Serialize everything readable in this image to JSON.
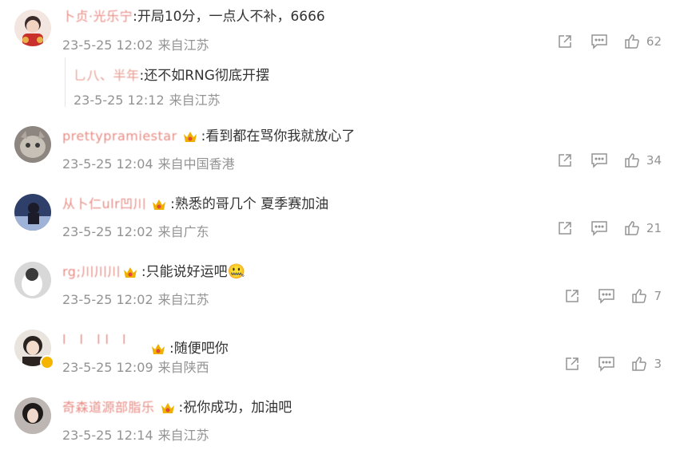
{
  "comments": [
    {
      "username": "卜贞·光乐宁",
      "has_crown": false,
      "text": ":开局10分，一点人不补，6666",
      "datetime": "23-5-25 12:02",
      "location": "来自江苏",
      "likes": "62",
      "reply": {
        "username": "乚八、半年",
        "text": ":还不如RNG彻底开摆",
        "datetime": "23-5-25 12:12",
        "location": "来自江苏"
      }
    },
    {
      "username": "prettypramiestar",
      "has_crown": true,
      "text": ":看到都在骂你我就放心了",
      "datetime": "23-5-25 12:04",
      "location": "来自中国香港",
      "likes": "34"
    },
    {
      "username": "从卜仁ulr凹川",
      "has_crown": true,
      "text": ":熟悉的哥几个 夏季赛加油",
      "datetime": "23-5-25 12:02",
      "location": "来自广东",
      "likes": "21"
    },
    {
      "username": "rg;川川川",
      "has_crown": true,
      "text": ":只能说好运吧",
      "emoji": "🤐",
      "datetime": "23-5-25 12:02",
      "location": "来自江苏",
      "likes": "7"
    },
    {
      "username": "l  l  ll  l",
      "has_crown": true,
      "text": ":随便吧你",
      "datetime": "23-5-25 12:09",
      "location": "来自陕西",
      "likes": "3"
    },
    {
      "username": "奇森道源部脂乐",
      "has_crown": true,
      "text": ":祝你成功，加油吧",
      "datetime": "23-5-25 12:14",
      "location": "来自江苏"
    }
  ],
  "colors": {
    "meta": "#939393",
    "text": "#333333",
    "crown": "#f0b000"
  }
}
